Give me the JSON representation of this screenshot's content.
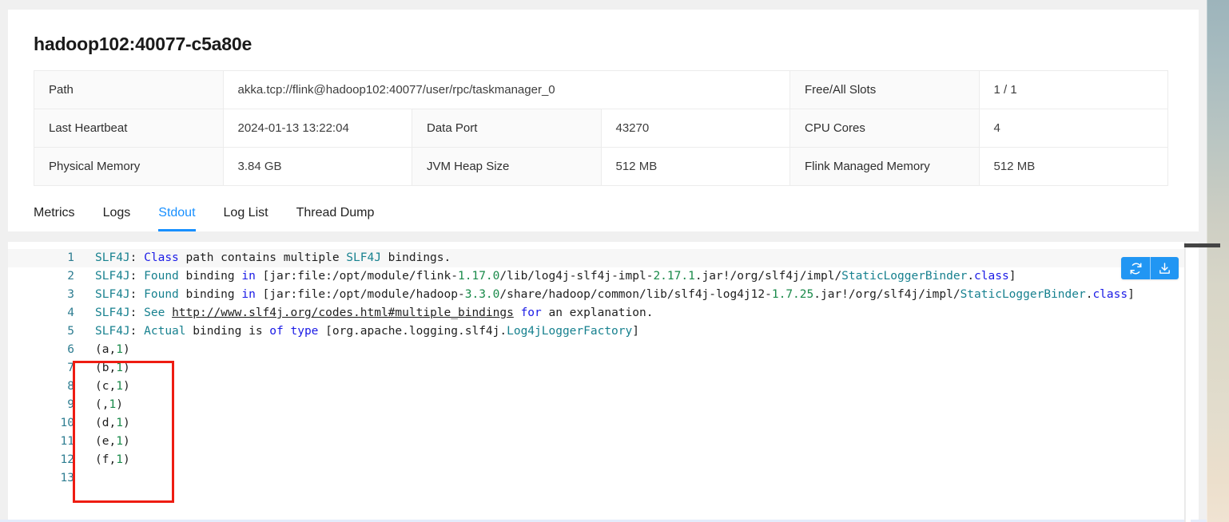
{
  "header": {
    "title": "hadoop102:40077-c5a80e"
  },
  "info_table": {
    "rows": [
      [
        {
          "kind": "label",
          "text": "Path",
          "colspan": 1
        },
        {
          "kind": "value",
          "text": "akka.tcp://flink@hadoop102:40077/user/rpc/taskmanager_0",
          "colspan": 3
        },
        {
          "kind": "label",
          "text": "Free/All Slots",
          "colspan": 1
        },
        {
          "kind": "value",
          "text": "1 / 1",
          "colspan": 1
        }
      ],
      [
        {
          "kind": "label",
          "text": "Last Heartbeat",
          "colspan": 1
        },
        {
          "kind": "value",
          "text": "2024-01-13 13:22:04",
          "colspan": 1
        },
        {
          "kind": "label",
          "text": "Data Port",
          "colspan": 1
        },
        {
          "kind": "value",
          "text": "43270",
          "colspan": 1
        },
        {
          "kind": "label",
          "text": "CPU Cores",
          "colspan": 1
        },
        {
          "kind": "value",
          "text": "4",
          "colspan": 1
        }
      ],
      [
        {
          "kind": "label",
          "text": "Physical Memory",
          "colspan": 1
        },
        {
          "kind": "value",
          "text": "3.84 GB",
          "colspan": 1
        },
        {
          "kind": "label",
          "text": "JVM Heap Size",
          "colspan": 1
        },
        {
          "kind": "value",
          "text": "512 MB",
          "colspan": 1
        },
        {
          "kind": "label",
          "text": "Flink Managed Memory",
          "colspan": 1
        },
        {
          "kind": "value",
          "text": "512 MB",
          "colspan": 1
        }
      ]
    ]
  },
  "tabs": {
    "items": [
      {
        "label": "Metrics",
        "active": false
      },
      {
        "label": "Logs",
        "active": false
      },
      {
        "label": "Stdout",
        "active": true
      },
      {
        "label": "Log List",
        "active": false
      },
      {
        "label": "Thread Dump",
        "active": false
      }
    ],
    "active_color": "#1890ff"
  },
  "log_actions": {
    "refresh_label": "refresh-icon",
    "download_label": "download-icon",
    "background": "#2196f3"
  },
  "annotation": {
    "box_color": "#ee1c12"
  },
  "log": {
    "lines": [
      {
        "number": "1",
        "highlighted": true,
        "tokens": [
          {
            "t": "SLF4J",
            "c": "teal"
          },
          {
            "t": ": ",
            "c": "plain"
          },
          {
            "t": "Class",
            "c": "blue"
          },
          {
            "t": " path contains multiple ",
            "c": "plain"
          },
          {
            "t": "SLF4J",
            "c": "teal"
          },
          {
            "t": " bindings.",
            "c": "plain"
          }
        ]
      },
      {
        "number": "2",
        "highlighted": false,
        "tokens": [
          {
            "t": "SLF4J",
            "c": "teal"
          },
          {
            "t": ": ",
            "c": "plain"
          },
          {
            "t": "Found",
            "c": "teal"
          },
          {
            "t": " binding ",
            "c": "plain"
          },
          {
            "t": "in",
            "c": "blue"
          },
          {
            "t": " [jar:file:/opt/module/flink-",
            "c": "plain"
          },
          {
            "t": "1.17.0",
            "c": "green"
          },
          {
            "t": "/lib/log4j-slf4j-impl-",
            "c": "plain"
          },
          {
            "t": "2.17.1",
            "c": "green"
          },
          {
            "t": ".jar!/org/slf4j/impl/",
            "c": "plain"
          },
          {
            "t": "StaticLoggerBinder",
            "c": "teal"
          },
          {
            "t": ".",
            "c": "plain"
          },
          {
            "t": "class",
            "c": "blue"
          },
          {
            "t": "]",
            "c": "plain"
          }
        ]
      },
      {
        "number": "3",
        "highlighted": false,
        "tokens": [
          {
            "t": "SLF4J",
            "c": "teal"
          },
          {
            "t": ": ",
            "c": "plain"
          },
          {
            "t": "Found",
            "c": "teal"
          },
          {
            "t": " binding ",
            "c": "plain"
          },
          {
            "t": "in",
            "c": "blue"
          },
          {
            "t": " [jar:file:/opt/module/hadoop-",
            "c": "plain"
          },
          {
            "t": "3.3.0",
            "c": "green"
          },
          {
            "t": "/share/hadoop/common/lib/slf4j-log4j12-",
            "c": "plain"
          },
          {
            "t": "1.7.25",
            "c": "green"
          },
          {
            "t": ".jar!/org/slf4j/impl/",
            "c": "plain"
          },
          {
            "t": "StaticLoggerBinder",
            "c": "teal"
          },
          {
            "t": ".",
            "c": "plain"
          },
          {
            "t": "class",
            "c": "blue"
          },
          {
            "t": "]",
            "c": "plain"
          }
        ]
      },
      {
        "number": "4",
        "highlighted": false,
        "tokens": [
          {
            "t": "SLF4J",
            "c": "teal"
          },
          {
            "t": ": ",
            "c": "plain"
          },
          {
            "t": "See",
            "c": "teal"
          },
          {
            "t": " ",
            "c": "plain"
          },
          {
            "t": "http://www.slf4j.org/codes.html#multiple_bindings",
            "c": "link"
          },
          {
            "t": " ",
            "c": "plain"
          },
          {
            "t": "for",
            "c": "blue"
          },
          {
            "t": " an explanation.",
            "c": "plain"
          }
        ]
      },
      {
        "number": "5",
        "highlighted": false,
        "tokens": [
          {
            "t": "SLF4J",
            "c": "teal"
          },
          {
            "t": ": ",
            "c": "plain"
          },
          {
            "t": "Actual",
            "c": "teal"
          },
          {
            "t": " binding is ",
            "c": "plain"
          },
          {
            "t": "of",
            "c": "blue"
          },
          {
            "t": " ",
            "c": "plain"
          },
          {
            "t": "type",
            "c": "blue"
          },
          {
            "t": " [org.apache.logging.slf4j.",
            "c": "plain"
          },
          {
            "t": "Log4jLoggerFactory",
            "c": "teal"
          },
          {
            "t": "]",
            "c": "plain"
          }
        ]
      },
      {
        "number": "6",
        "highlighted": false,
        "tokens": [
          {
            "t": "(a,",
            "c": "plain"
          },
          {
            "t": "1",
            "c": "green"
          },
          {
            "t": ")",
            "c": "plain"
          }
        ]
      },
      {
        "number": "7",
        "highlighted": false,
        "tokens": [
          {
            "t": "(b,",
            "c": "plain"
          },
          {
            "t": "1",
            "c": "green"
          },
          {
            "t": ")",
            "c": "plain"
          }
        ]
      },
      {
        "number": "8",
        "highlighted": false,
        "tokens": [
          {
            "t": "(c,",
            "c": "plain"
          },
          {
            "t": "1",
            "c": "green"
          },
          {
            "t": ")",
            "c": "plain"
          }
        ]
      },
      {
        "number": "9",
        "highlighted": false,
        "tokens": [
          {
            "t": "(,",
            "c": "plain"
          },
          {
            "t": "1",
            "c": "green"
          },
          {
            "t": ")",
            "c": "plain"
          }
        ]
      },
      {
        "number": "10",
        "highlighted": false,
        "tokens": [
          {
            "t": "(d,",
            "c": "plain"
          },
          {
            "t": "1",
            "c": "green"
          },
          {
            "t": ")",
            "c": "plain"
          }
        ]
      },
      {
        "number": "11",
        "highlighted": false,
        "tokens": [
          {
            "t": "(e,",
            "c": "plain"
          },
          {
            "t": "1",
            "c": "green"
          },
          {
            "t": ")",
            "c": "plain"
          }
        ]
      },
      {
        "number": "12",
        "highlighted": false,
        "tokens": [
          {
            "t": "(f,",
            "c": "plain"
          },
          {
            "t": "1",
            "c": "green"
          },
          {
            "t": ")",
            "c": "plain"
          }
        ]
      },
      {
        "number": "13",
        "highlighted": false,
        "tokens": []
      }
    ]
  }
}
